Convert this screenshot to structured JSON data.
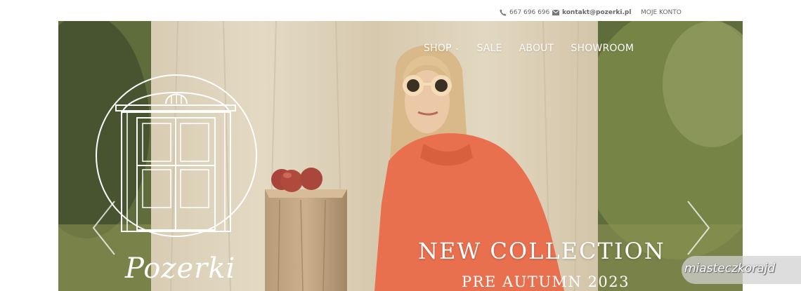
{
  "topbar": {
    "phone": "667 696 696",
    "email": "kontakt@pozerki.pl",
    "account": "MOJE KONTO",
    "phone_icon": "phone-icon",
    "email_icon": "envelope-icon"
  },
  "nav": {
    "items": [
      "SHOP",
      "SALE",
      "ABOUT",
      "SHOWROOM"
    ],
    "shop_dropdown_icon": "chevron-down-icon"
  },
  "hero": {
    "headline": "NEW COLLECTION",
    "subheadline": "PRE AUTUMN 2023",
    "prev_icon": "chevron-left-icon",
    "next_icon": "chevron-right-icon"
  },
  "brand": {
    "logo_text": "Pozerki"
  },
  "watermark": {
    "text": "miasteczkorajd"
  },
  "colors": {
    "nav_text": "#ffffff",
    "topbar_text": "#666666",
    "sweatshirt": "#e8704f",
    "curtain": "#d9cdb4"
  }
}
